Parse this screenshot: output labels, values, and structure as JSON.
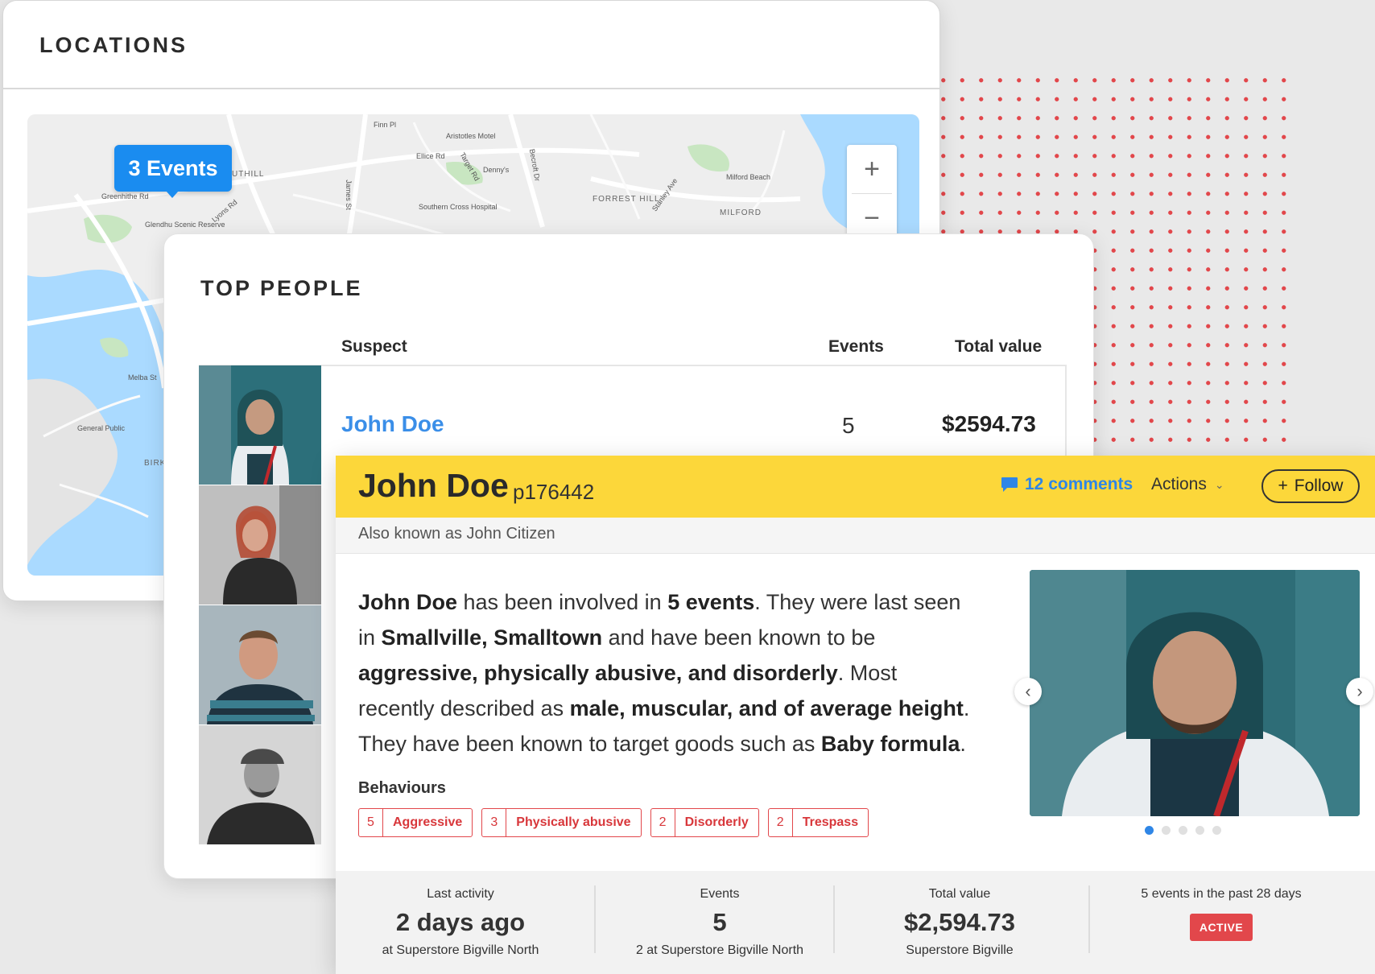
{
  "locations": {
    "title": "LOCATIONS",
    "pin_label": "3 Events",
    "zoom_in": "+",
    "zoom_out": "−",
    "map_labels": [
      "Finn Pl",
      "Aristotles Motel",
      "Ellice Rd",
      "Denny's",
      "Target Rd",
      "Becroft Dr",
      "Greenhithe Rd",
      "UTHILL",
      "Glendhu Scenic Reserve",
      "Lyons Rd",
      "James St",
      "Southern Cross Hospital",
      "FORREST HILL",
      "Stanley Ave",
      "Milford Beach",
      "MILFORD",
      "Melba St",
      "General Public",
      "BIRK"
    ]
  },
  "top_people": {
    "title": "TOP PEOPLE",
    "columns": {
      "suspect": "Suspect",
      "events": "Events",
      "total_value": "Total value"
    },
    "rows": [
      {
        "name": "John Doe",
        "events": "5",
        "total_value": "$2594.73"
      }
    ]
  },
  "profile": {
    "name": "John Doe",
    "id": "p176442",
    "comments": "12 comments",
    "actions_label": "Actions",
    "follow_label": "Follow",
    "aka": "Also known as John Citizen",
    "bio": {
      "name": "John Doe",
      "t1": " has been involved in ",
      "events": "5 events",
      "t2": ". They were last seen in ",
      "place": "Smallville, Smalltown",
      "t3": " and have been known to be ",
      "traits": "aggressive, physically abusive, and disorderly",
      "t4": ". Most recently described as ",
      "desc": "male, muscular, and of average height",
      "t5": ". They have been known to target goods such as ",
      "goods": "Baby formula",
      "t6": "."
    },
    "behaviours_title": "Behaviours",
    "behaviours": [
      {
        "count": "5",
        "label": "Aggressive"
      },
      {
        "count": "3",
        "label": "Physically abusive"
      },
      {
        "count": "2",
        "label": "Disorderly"
      },
      {
        "count": "2",
        "label": "Trespass"
      }
    ],
    "photo_pages": 5,
    "photo_current": 1,
    "stats": {
      "last_activity": {
        "label": "Last activity",
        "value": "2 days ago",
        "sub": "at Superstore Bigville North"
      },
      "events": {
        "label": "Events",
        "value": "5",
        "sub": "2 at Superstore Bigville North"
      },
      "total_value": {
        "label": "Total value",
        "value": "$2,594.73",
        "sub": "Superstore Bigville"
      },
      "recent": {
        "label": "5 events in the past 28 days",
        "badge": "ACTIVE"
      }
    }
  },
  "colors": {
    "accent_yellow": "#fcd73a",
    "link_blue": "#2f86e6",
    "pin_blue": "#1a8cf0",
    "alert_red": "#e2474b"
  }
}
